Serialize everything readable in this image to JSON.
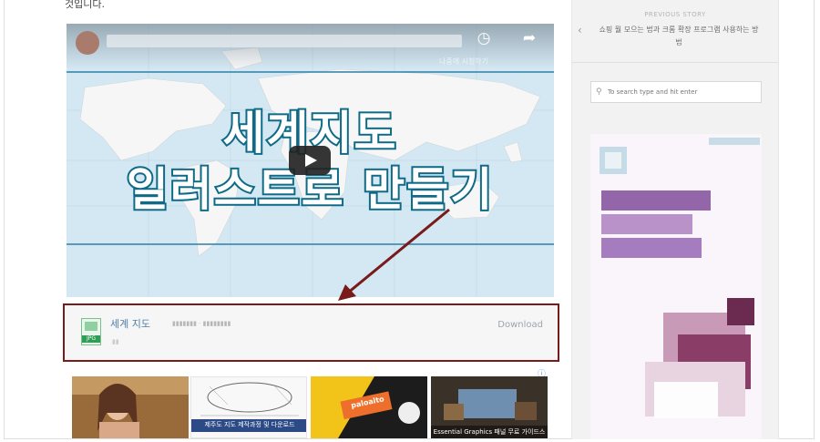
{
  "article": {
    "lead_text": "것입니다."
  },
  "video": {
    "headline_line1": "세계지도",
    "headline_line2": "일러스트로 만들기",
    "watch_later_label": "나중에 시청하기",
    "icons": {
      "watch_later": "clock-icon",
      "share": "share-icon",
      "play": "play-icon"
    }
  },
  "attachment": {
    "file_name": "세계 지도",
    "file_type": "JPG",
    "download_label": "Download"
  },
  "thumbnails": {
    "items": [
      {
        "caption": ""
      },
      {
        "caption": "제주도 지도 제작과정 및 다운로드"
      },
      {
        "caption": "paloalto"
      },
      {
        "caption": "Essential Graphics 패널 무료 가이드스"
      }
    ]
  },
  "sidebar": {
    "previous_label": "PREVIOUS STORY",
    "previous_title": "쇼핑 뭘 모으는 법과 크롬 확장 프로그램 사용하는 방법",
    "search_placeholder": "To search type and hit enter"
  },
  "colors": {
    "highlight_border": "#7a1b1b",
    "headline_stroke": "#0f6b86",
    "link_blue": "#4f7ea7"
  }
}
